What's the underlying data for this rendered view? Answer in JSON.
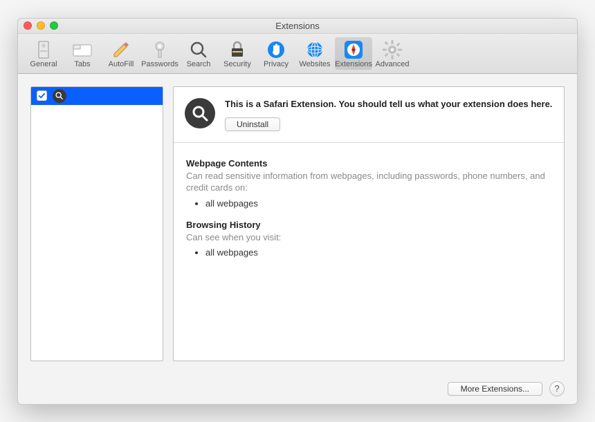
{
  "window": {
    "title": "Extensions"
  },
  "toolbar": {
    "items": [
      {
        "label": "General",
        "selected": false
      },
      {
        "label": "Tabs",
        "selected": false
      },
      {
        "label": "AutoFill",
        "selected": false
      },
      {
        "label": "Passwords",
        "selected": false
      },
      {
        "label": "Search",
        "selected": false
      },
      {
        "label": "Security",
        "selected": false
      },
      {
        "label": "Privacy",
        "selected": false
      },
      {
        "label": "Websites",
        "selected": false
      },
      {
        "label": "Extensions",
        "selected": true
      },
      {
        "label": "Advanced",
        "selected": false
      }
    ]
  },
  "sidebar": {
    "items": [
      {
        "checked": true
      }
    ]
  },
  "detail": {
    "description": "This is a Safari Extension. You should tell us what your extension does here.",
    "uninstall_label": "Uninstall",
    "sections": [
      {
        "title": "Webpage Contents",
        "subtitle": "Can read sensitive information from webpages, including passwords, phone numbers, and credit cards on:",
        "bullets": [
          "all webpages"
        ]
      },
      {
        "title": "Browsing History",
        "subtitle": "Can see when you visit:",
        "bullets": [
          "all webpages"
        ]
      }
    ]
  },
  "footer": {
    "more_extensions_label": "More Extensions...",
    "help_label": "?"
  }
}
